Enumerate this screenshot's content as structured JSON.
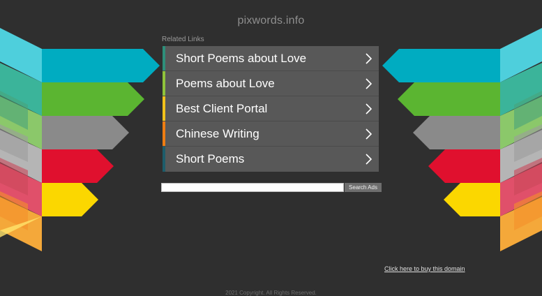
{
  "site": {
    "title": "pixwords.info"
  },
  "related": {
    "heading": "Related Links",
    "links": [
      {
        "label": "Short Poems about Love",
        "accent": "#2e8f7a"
      },
      {
        "label": "Poems about Love",
        "accent": "#8fc33a"
      },
      {
        "label": "Best Client Portal",
        "accent": "#f2c21b"
      },
      {
        "label": "Chinese Writing",
        "accent": "#ee7d12"
      },
      {
        "label": "Short Poems",
        "accent": "#1d5d6b"
      }
    ]
  },
  "search": {
    "button_label": "Search Ads",
    "value": ""
  },
  "buy_domain": {
    "label": "Click here to buy this domain"
  },
  "footer": {
    "text": "2021 Copyright. All Rights Reserved."
  },
  "colors": {
    "background": "#2f2f2f",
    "panel": "#585858",
    "cyan": "#00acc1",
    "green": "#5bb531",
    "gray": "#8a8a8a",
    "red": "#e0102e",
    "yellow": "#fbd700"
  },
  "icons": [
    "chevron-right-icon"
  ]
}
